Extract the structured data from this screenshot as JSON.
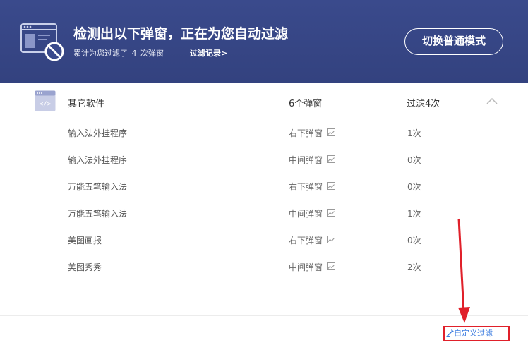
{
  "header": {
    "title": "检测出以下弹窗，正在为您自动过滤",
    "summary_prefix": "累计为您过滤了",
    "summary_count": "4",
    "summary_suffix": "次弹窗",
    "records_link": "过滤记录>",
    "mode_button": "切换普通模式",
    "icon": "blocked-window-icon"
  },
  "group": {
    "icon": "code-window-icon",
    "name": "其它软件",
    "popup_count": "6个弹窗",
    "filter_count": "过滤4次",
    "collapse_icon": "chevron-up-icon"
  },
  "rows": [
    {
      "name": "输入法外挂程序",
      "type": "右下弹窗",
      "count": "1次"
    },
    {
      "name": "输入法外挂程序",
      "type": "中间弹窗",
      "count": "0次"
    },
    {
      "name": "万能五笔输入法",
      "type": "右下弹窗",
      "count": "0次"
    },
    {
      "name": "万能五笔输入法",
      "type": "中间弹窗",
      "count": "1次"
    },
    {
      "name": "美图画报",
      "type": "右下弹窗",
      "count": "0次"
    },
    {
      "name": "美图秀秀",
      "type": "中间弹窗",
      "count": "2次"
    }
  ],
  "footer": {
    "custom_filter": "自定义过滤",
    "icon": "edit-icon"
  },
  "colors": {
    "header_bg": "#3a4a8c",
    "link_blue": "#3d7de0",
    "annotation_red": "#e0202a"
  }
}
